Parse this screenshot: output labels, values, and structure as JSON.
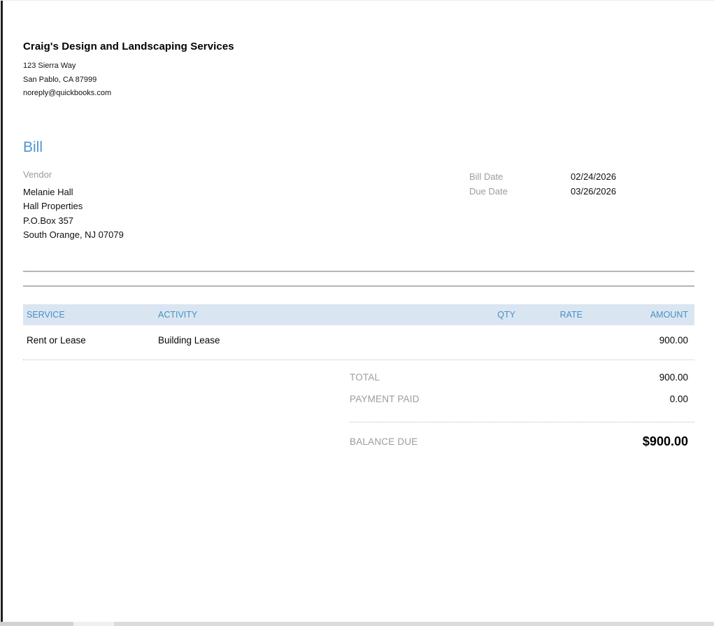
{
  "company": {
    "name": "Craig's Design and Landscaping Services",
    "address_line1": "123 Sierra Way",
    "address_line2": "San Pablo, CA  87999",
    "email": "noreply@quickbooks.com"
  },
  "document": {
    "title": "Bill",
    "vendor_label": "Vendor",
    "vendor_lines": [
      "Melanie Hall",
      "Hall Properties",
      "P.O.Box 357",
      "South Orange, NJ  07079"
    ],
    "bill_date_label": "Bill Date",
    "bill_date_value": "02/24/2026",
    "due_date_label": "Due Date",
    "due_date_value": "03/26/2026"
  },
  "table": {
    "headers": [
      "SERVICE",
      "ACTIVITY",
      "QTY",
      "RATE",
      "AMOUNT"
    ],
    "rows": [
      {
        "service": "Rent or Lease",
        "activity": "Building Lease",
        "qty": "",
        "rate": "",
        "amount": "900.00"
      }
    ]
  },
  "totals": {
    "total_label": "TOTAL",
    "total_value": "900.00",
    "payment_label": "PAYMENT PAID",
    "payment_value": "0.00",
    "balance_label": "BALANCE DUE",
    "balance_value": "$900.00"
  },
  "colors": {
    "accent_blue": "#5094ce",
    "table_header_bg": "#d9e6f1",
    "table_header_text": "#4a8fc4",
    "label_gray": "#9c9c9c"
  }
}
